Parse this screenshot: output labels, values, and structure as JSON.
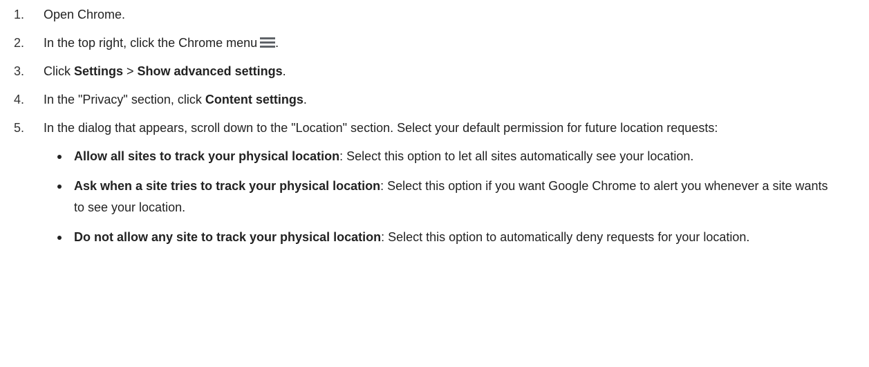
{
  "steps": [
    {
      "number": "1.",
      "text": "Open Chrome."
    },
    {
      "number": "2.",
      "text": "In the top right, click the Chrome menu",
      "icon": "hamburger-menu-icon",
      "suffix": "."
    },
    {
      "number": "3.",
      "prefix": "Click ",
      "bold1": "Settings",
      "separator": " > ",
      "bold2": "Show advanced settings",
      "suffix": "."
    },
    {
      "number": "4.",
      "prefix": "In the \"Privacy\" section, click ",
      "bold": "Content settings",
      "suffix": "."
    },
    {
      "number": "5.",
      "text": "In the dialog that appears, scroll down to the \"Location\" section. Select your default permission for future location requests:",
      "options": [
        {
          "bold": "Allow all sites to track your physical location",
          "text": ": Select this option to let all sites automatically see your location."
        },
        {
          "bold": "Ask when a site tries to track your physical location",
          "text": ": Select this option if you want Google Chrome to alert you whenever a site wants to see your location."
        },
        {
          "bold": "Do not allow any site to track your physical location",
          "text": ": Select this option to automatically deny requests for your location."
        }
      ]
    }
  ],
  "colors": {
    "text": "#222222",
    "icon": "#5f6368",
    "background": "#ffffff"
  }
}
